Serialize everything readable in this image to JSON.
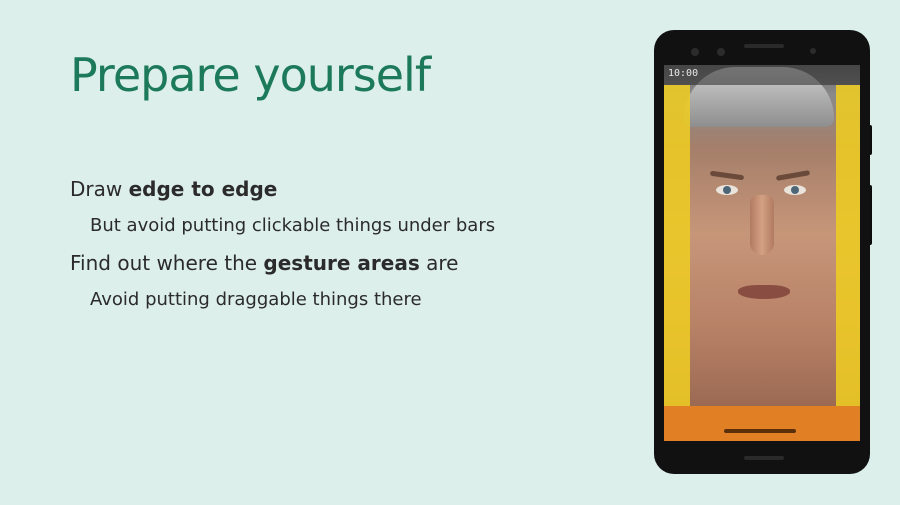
{
  "slide": {
    "title": "Prepare yourself",
    "bullets": [
      {
        "pre": "Draw ",
        "bold": "edge to edge",
        "post": ""
      },
      {
        "text": "But avoid putting clickable things under bars"
      },
      {
        "pre": "Find out where the ",
        "bold": "gesture areas",
        "post": " are"
      },
      {
        "text": "Avoid putting draggable things there"
      }
    ]
  },
  "phone": {
    "status_time": "10:00",
    "gesture_color": "#eecc22",
    "nav_bar_color": "#e07f24"
  }
}
